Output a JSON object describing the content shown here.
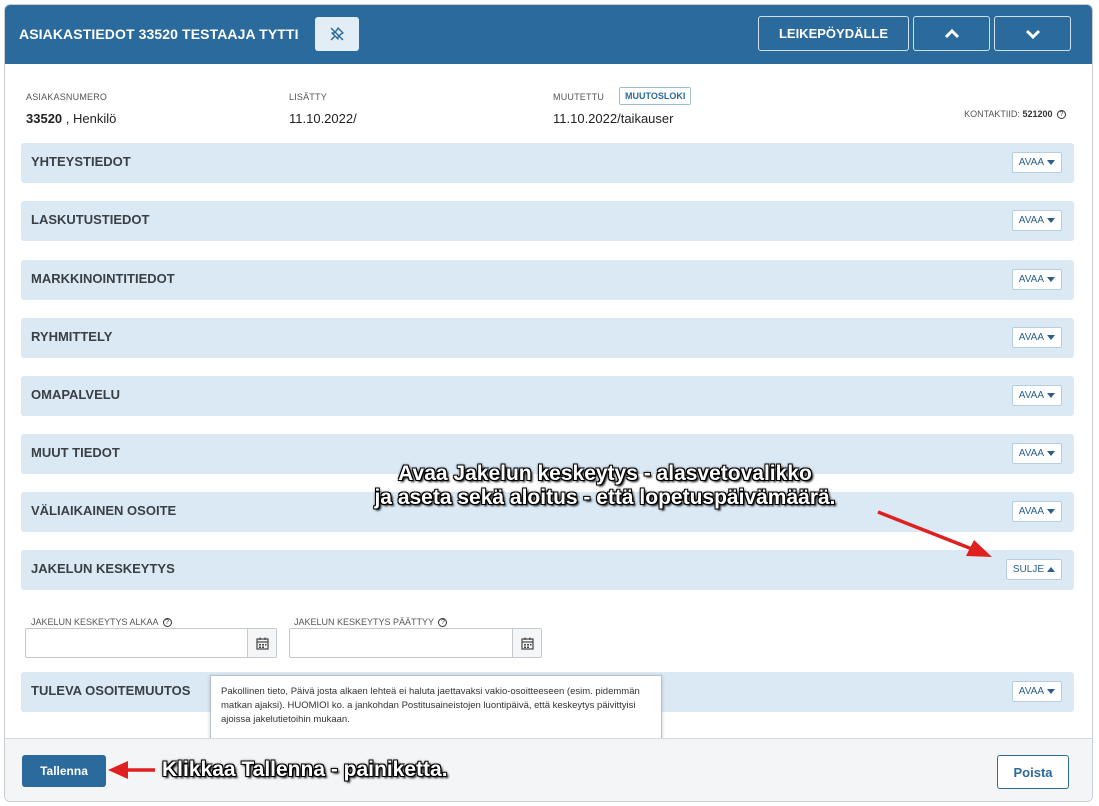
{
  "header": {
    "title": "ASIAKASTIEDOT 33520 TESTAAJA TYTTI",
    "clipboard_label": "LEIKEPÖYDÄLLE",
    "unpin_icon": "unpin-icon",
    "up_icon": "chevron-up-icon",
    "down_icon": "chevron-down-icon"
  },
  "meta": {
    "customer_number_label": "ASIAKASNUMERO",
    "customer_number": "33520",
    "customer_type": ", Henkilö",
    "added_label": "LISÄTTY",
    "added_value": "11.10.2022/",
    "modified_label": "MUUTETTU",
    "changelog_label": "MUUTOSLOKI",
    "modified_value": "11.10.2022/taikauser",
    "contact_id_label": "KONTAKTIID:",
    "contact_id": "521200"
  },
  "sections": [
    {
      "title": "YHTEYSTIEDOT",
      "button": "AVAA"
    },
    {
      "title": "LASKUTUSTIEDOT",
      "button": "AVAA"
    },
    {
      "title": "MARKKINOINTITIEDOT",
      "button": "AVAA"
    },
    {
      "title": "RYHMITTELY",
      "button": "AVAA"
    },
    {
      "title": "OMAPALVELU",
      "button": "AVAA"
    },
    {
      "title": "MUUT TIEDOT",
      "button": "AVAA"
    },
    {
      "title": "VÄLIAIKAINEN OSOITE",
      "button": "AVAA"
    },
    {
      "title": "JAKELUN KESKEYTYS",
      "button": "SULJE"
    },
    {
      "title": "TULEVA OSOITEMUUTOS",
      "button": "AVAA"
    }
  ],
  "suspension": {
    "start_label": "JAKELUN KESKEYTYS ALKAA",
    "start_value": "",
    "end_label": "JAKELUN KESKEYTYS PÄÄTTYY",
    "end_value": ""
  },
  "tooltip": {
    "text": "Pakollinen tieto, Päivä josta alkaen lehteä ei haluta jaettavaksi vakio-osoitteeseen (esim. pidemmän matkan ajaksi). HUOMIOI ko. a jankohdan Postitusaineistojen luontipäivä, että keskeytys päivittyisi ajoissa jakelutietoihin mukaan."
  },
  "footer": {
    "save_label": "Tallenna",
    "delete_label": "Poista"
  },
  "annotations": {
    "line1": "Avaa Jakelun keskeytys - alasvetovalikko",
    "line2": "ja aseta sekä aloitus - että lopetuspäivämäärä.",
    "save_hint": "Klikkaa Tallenna - painiketta."
  },
  "colors": {
    "header_bg": "#2b6a9c",
    "section_bg": "#dbe9f5",
    "arrow": "#e02020"
  }
}
